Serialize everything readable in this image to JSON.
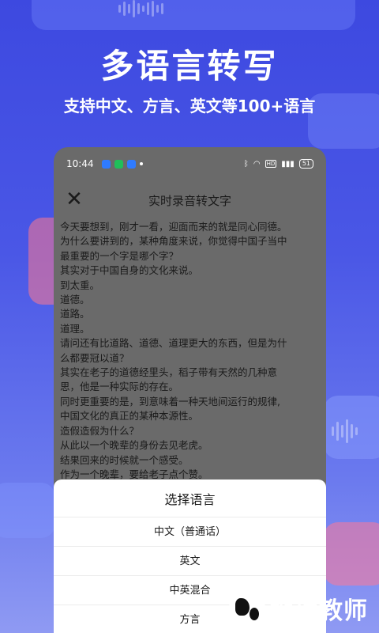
{
  "promo": {
    "headline": "多语言转写",
    "subheadline": "支持中文、方言、英文等100+语言"
  },
  "status_bar": {
    "time": "10:44",
    "battery": "51",
    "notification_colors": [
      "#2f7bff",
      "#1fbf5a",
      "#2f7bff"
    ]
  },
  "app": {
    "title": "实时录音转文字",
    "close_icon": "close-icon"
  },
  "transcript": {
    "lines": [
      "今天要想到，刚才一看，迎面而来的就是同心同德。",
      "为什么要讲到的，某种角度来说，你觉得中国子当中",
      "最重要的一个字是哪个字？",
      "其实对于中国自身的文化来说。",
      "到太重。",
      "道德。",
      "道路。",
      "道理。",
      "请问还有比道路、道德、道理更大的东西，但是为什",
      "么都要冠以道？",
      "其实在老子的道德经里头，稻子带有天然的几种意",
      "思，他是一种实际的存在。",
      "同时更重要的是，到意味着一种天地间运行的规律,",
      "中国文化的真正的某种本源性。",
      "造假造假为什么？",
      "从此以一个晚辈的身份去见老虎。",
      "结果回来的时候就一个感受。",
      "作为一个晚辈，要给老子点个赞。"
    ]
  },
  "language_sheet": {
    "title": "选择语言",
    "options": [
      "中文（普通话）",
      "英文",
      "中英混合",
      "方言"
    ]
  },
  "watermark": {
    "text": "地理教师"
  }
}
